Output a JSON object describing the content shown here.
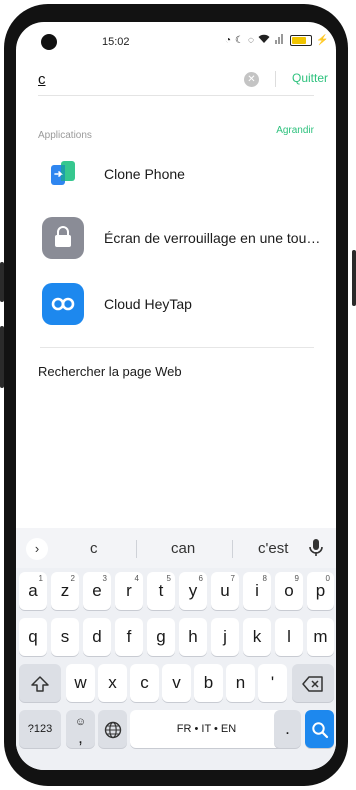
{
  "status_bar": {
    "time": "15:02",
    "icons": [
      "alarm-icon",
      "do-not-disturb-icon",
      "hotspot-icon",
      "wifi-icon",
      "signal-icon",
      "battery-charging-icon"
    ]
  },
  "search": {
    "query": "c",
    "clear_icon": "clear-icon",
    "quit_label": "Quitter"
  },
  "applications": {
    "title": "Applications",
    "expand_label": "Agrandir",
    "items": [
      {
        "label": "Clone Phone",
        "icon": "clone-phone-icon"
      },
      {
        "label": "Écran de verrouillage en une tou…",
        "icon": "lock-screen-icon"
      },
      {
        "label": "Cloud HeyTap",
        "icon": "cloud-heytap-icon"
      }
    ]
  },
  "web_search": {
    "label": "Rechercher la page Web"
  },
  "keyboard": {
    "suggestions": [
      "c",
      "can",
      "c'est"
    ],
    "row1": [
      {
        "k": "a",
        "h": "1"
      },
      {
        "k": "z",
        "h": "2"
      },
      {
        "k": "e",
        "h": "3"
      },
      {
        "k": "r",
        "h": "4"
      },
      {
        "k": "t",
        "h": "5"
      },
      {
        "k": "y",
        "h": "6"
      },
      {
        "k": "u",
        "h": "7"
      },
      {
        "k": "i",
        "h": "8"
      },
      {
        "k": "o",
        "h": "9"
      },
      {
        "k": "p",
        "h": "0"
      }
    ],
    "row2": [
      "q",
      "s",
      "d",
      "f",
      "g",
      "h",
      "j",
      "k",
      "l",
      "m"
    ],
    "row3": [
      "w",
      "x",
      "c",
      "v",
      "b",
      "n",
      "'"
    ],
    "symbols_label": "?123",
    "emoji_comma": ",",
    "space_label": "FR • IT • EN",
    "period": ".",
    "accent_color": "#1d88ee"
  },
  "colors": {
    "accent_green": "#2ec27e",
    "keyboard_bg": "#eef0f4"
  }
}
